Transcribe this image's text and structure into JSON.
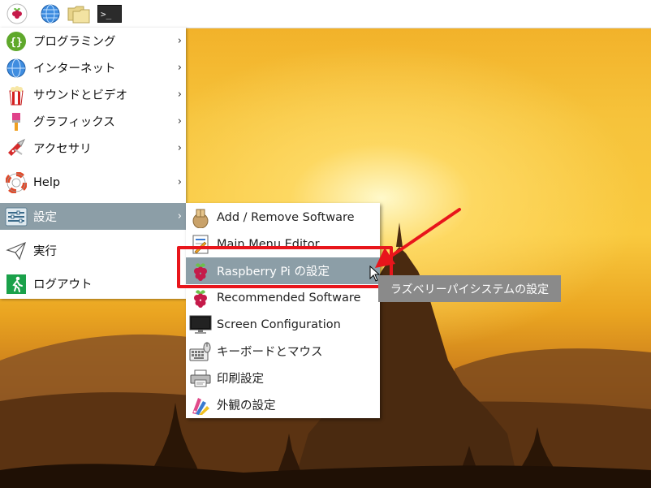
{
  "panel": {
    "buttons": [
      {
        "icon": "raspberry-pi-menu-icon"
      },
      {
        "icon": "globe-browser-icon"
      },
      {
        "icon": "file-manager-folder-icon"
      },
      {
        "icon": "terminal-icon",
        "glyph": ">_"
      }
    ]
  },
  "menu": {
    "items": [
      {
        "label": "プログラミング",
        "icon": "programming-icon",
        "has_submenu": true
      },
      {
        "label": "インターネット",
        "icon": "internet-globe-icon",
        "has_submenu": true
      },
      {
        "label": "サウンドとビデオ",
        "icon": "popcorn-icon",
        "has_submenu": true
      },
      {
        "label": "グラフィックス",
        "icon": "paintbrush-icon",
        "has_submenu": true
      },
      {
        "label": "アクセサリ",
        "icon": "swiss-knife-icon",
        "has_submenu": true
      },
      {
        "label": "Help",
        "icon": "lifebuoy-icon",
        "has_submenu": true
      },
      {
        "label": "設定",
        "icon": "preferences-sliders-icon",
        "has_submenu": true,
        "active": true
      },
      {
        "label": "実行",
        "icon": "paper-plane-icon",
        "has_submenu": false
      },
      {
        "label": "ログアウト",
        "icon": "exit-running-man-icon",
        "has_submenu": false
      }
    ],
    "chevron": "›"
  },
  "submenu": {
    "items": [
      {
        "label": "Add / Remove Software",
        "icon": "package-box-icon"
      },
      {
        "label": "Main Menu Editor",
        "icon": "menu-editor-icon"
      },
      {
        "label": "Raspberry Pi の設定",
        "icon": "raspberry-icon",
        "active": true
      },
      {
        "label": "Recommended Software",
        "icon": "raspberry-icon"
      },
      {
        "label": "Screen Configuration",
        "icon": "monitor-icon"
      },
      {
        "label": "キーボードとマウス",
        "icon": "keyboard-mouse-icon"
      },
      {
        "label": "印刷設定",
        "icon": "printer-icon"
      },
      {
        "label": "外観の設定",
        "icon": "appearance-palette-icon"
      }
    ]
  },
  "tooltip": {
    "text": "ラズベリーパイシステムの設定"
  },
  "colors": {
    "menu_active_bg": "#8c9ea7",
    "annotation_red": "#e8151b",
    "tooltip_bg": "#8a8a8a",
    "raspberry_red": "#c51a4a",
    "raspberry_leaf": "#6cc04a"
  }
}
